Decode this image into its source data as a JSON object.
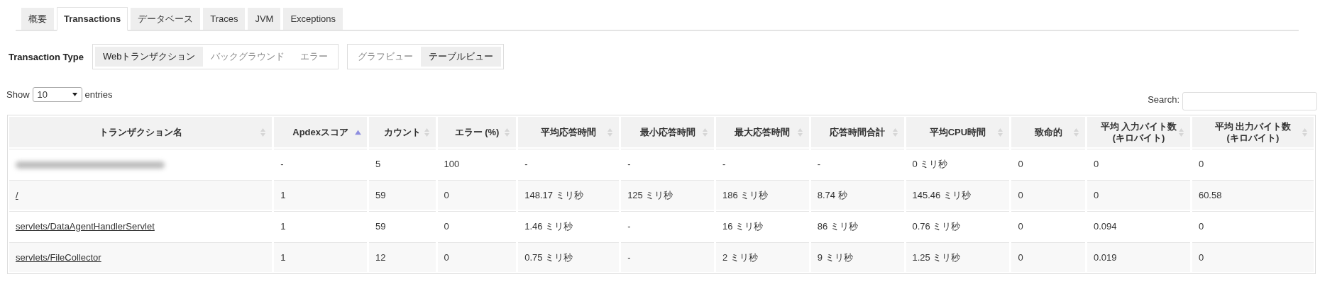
{
  "tabs": [
    {
      "label": "概要",
      "selected": false
    },
    {
      "label": "Transactions",
      "selected": true
    },
    {
      "label": "データベース",
      "selected": false
    },
    {
      "label": "Traces",
      "selected": false
    },
    {
      "label": "JVM",
      "selected": false
    },
    {
      "label": "Exceptions",
      "selected": false
    }
  ],
  "transaction_type": {
    "label": "Transaction Type",
    "options": [
      {
        "label": "Webトランザクション",
        "selected": true
      },
      {
        "label": "バックグラウンド",
        "selected": false
      },
      {
        "label": "エラー",
        "selected": false
      }
    ]
  },
  "view": {
    "options": [
      {
        "label": "グラフビュー",
        "selected": false
      },
      {
        "label": "テーブルビュー",
        "selected": true
      }
    ]
  },
  "length": {
    "prefix": "Show",
    "value": "10",
    "suffix": "entries"
  },
  "search": {
    "label": "Search:"
  },
  "table": {
    "columns": [
      {
        "label": "トランザクション名",
        "sorted_ascending": false
      },
      {
        "label": "Apdexスコア",
        "sorted_ascending": true
      },
      {
        "label": "カウント",
        "sorted_ascending": false
      },
      {
        "label": "エラー (%)",
        "sorted_ascending": false
      },
      {
        "label": "平均応答時間",
        "sorted_ascending": false
      },
      {
        "label": "最小応答時間",
        "sorted_ascending": false
      },
      {
        "label": "最大応答時間",
        "sorted_ascending": false
      },
      {
        "label": "応答時間合計",
        "sorted_ascending": false
      },
      {
        "label": "平均CPU時間",
        "sorted_ascending": false
      },
      {
        "label": "致命的",
        "sorted_ascending": false
      },
      {
        "label": "平均 入力バイト数\n(キロバイト)",
        "sorted_ascending": false
      },
      {
        "label": "平均 出力バイト数\n(キロバイト)",
        "sorted_ascending": false
      }
    ],
    "rows": [
      {
        "name_blurred": true,
        "cells": [
          "",
          "-",
          "5",
          "100",
          "-",
          "-",
          "-",
          "-",
          "0 ミリ秒",
          "0",
          "0",
          "0"
        ]
      },
      {
        "name_blurred": false,
        "cells": [
          "/",
          "1",
          "59",
          "0",
          "148.17 ミリ秒",
          "125 ミリ秒",
          "186 ミリ秒",
          "8.74 秒",
          "145.46 ミリ秒",
          "0",
          "0",
          "60.58"
        ]
      },
      {
        "name_blurred": false,
        "cells": [
          "servlets/DataAgentHandlerServlet",
          "1",
          "59",
          "0",
          "1.46 ミリ秒",
          "-",
          "16 ミリ秒",
          "86 ミリ秒",
          "0.76 ミリ秒",
          "0",
          "0.094",
          "0"
        ]
      },
      {
        "name_blurred": false,
        "cells": [
          "servlets/FileCollector",
          "1",
          "12",
          "0",
          "0.75 ミリ秒",
          "-",
          "2 ミリ秒",
          "9 ミリ秒",
          "1.25 ミリ秒",
          "0",
          "0.019",
          "0"
        ]
      }
    ]
  }
}
